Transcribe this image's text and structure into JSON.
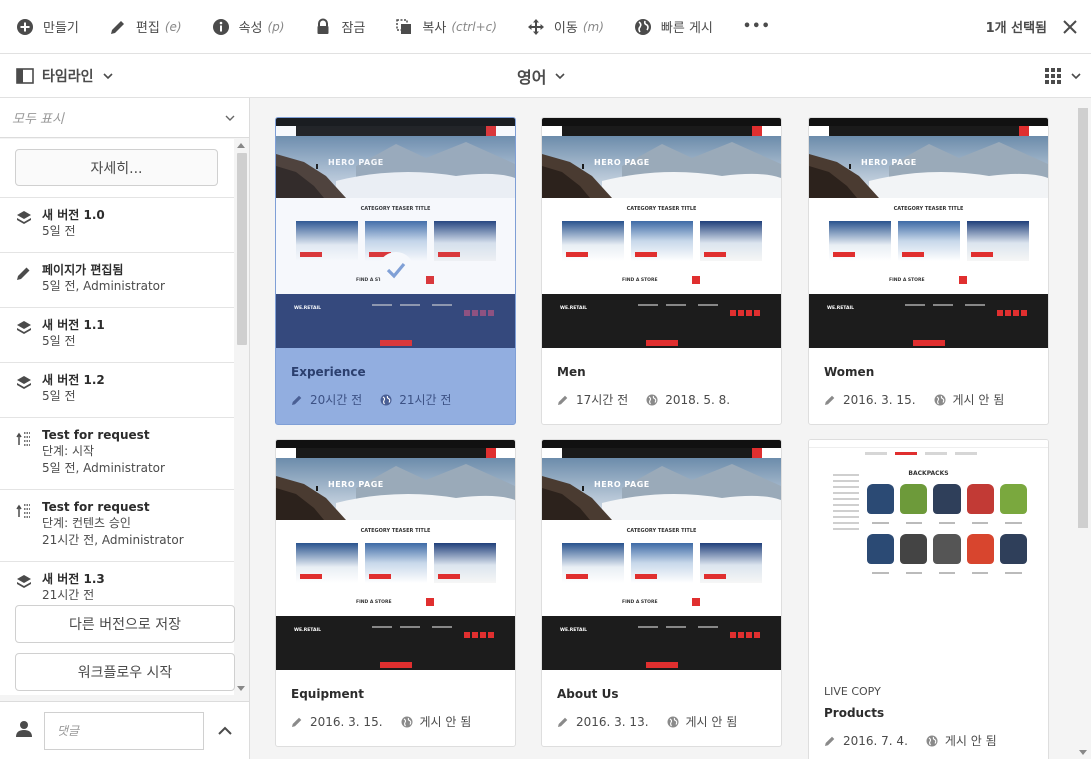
{
  "toolbar": {
    "create": "만들기",
    "edit": "편집",
    "edit_key": "(e)",
    "properties": "속성",
    "properties_key": "(p)",
    "lock": "잠금",
    "copy": "복사",
    "copy_key": "(ctrl+c)",
    "move": "이동",
    "move_key": "(m)",
    "quick_publish": "빠른 게시",
    "more": "•••",
    "selection_count": "1개 선택됨"
  },
  "subbar": {
    "rail": "타임라인",
    "language": "영어"
  },
  "rail": {
    "filter": "모두 표시",
    "more_button": "자세히...",
    "items": [
      {
        "title": "새 버전 1.0",
        "line1": "5일 전",
        "line2": ""
      },
      {
        "title": "페이지가 편집됨",
        "line1": "5일 전, Administrator",
        "line2": ""
      },
      {
        "title": "새 버전 1.1",
        "line1": "5일 전",
        "line2": ""
      },
      {
        "title": "새 버전 1.2",
        "line1": "5일 전",
        "line2": ""
      },
      {
        "title": "Test for request",
        "line1": "단계: 시작",
        "line2": "5일 전, Administrator"
      },
      {
        "title": "Test for request",
        "line1": "단계: 컨텐츠 승인",
        "line2": "21시간 전, Administrator"
      },
      {
        "title": "새 버전 1.3",
        "line1": "21시간 전",
        "line2": ""
      }
    ],
    "save_version": "다른 버전으로 저장",
    "start_workflow": "워크플로우 시작",
    "comment_placeholder": "댓글"
  },
  "cards": [
    {
      "title": "Experience",
      "label": "",
      "modified": "20시간 전",
      "published": "21시간 전",
      "selected": true,
      "thumb_type": "page",
      "hero_text": "HERO PAGE"
    },
    {
      "title": "Men",
      "label": "",
      "modified": "17시간 전",
      "published": "2018. 5. 8.",
      "selected": false,
      "thumb_type": "page",
      "hero_text": "HERO PAGE"
    },
    {
      "title": "Women",
      "label": "",
      "modified": "2016. 3. 15.",
      "published": "게시 안 됨",
      "selected": false,
      "thumb_type": "page",
      "hero_text": "HERO PAGE"
    },
    {
      "title": "Equipment",
      "label": "",
      "modified": "2016. 3. 15.",
      "published": "게시 안 됨",
      "selected": false,
      "thumb_type": "page",
      "hero_text": "HERO PAGE"
    },
    {
      "title": "About Us",
      "label": "",
      "modified": "2016. 3. 13.",
      "published": "게시 안 됨",
      "selected": false,
      "thumb_type": "page",
      "hero_text": "HERO PAGE"
    },
    {
      "title": "Products",
      "label": "LIVE COPY",
      "modified": "2016. 7. 4.",
      "published": "게시 안 됨",
      "selected": false,
      "thumb_type": "products",
      "hero_text": "BACKPACKS"
    }
  ],
  "thumb_text": {
    "teaser_title": "CATEGORY TEASER TITLE",
    "find_store": "FIND A STORE",
    "brand": "WE.RETAIL"
  },
  "colors": {
    "accent": "#e02f2f",
    "selected_card": "#92aee0",
    "text": "#4b4b4b"
  },
  "icons": {
    "create": "plus-circle-icon",
    "edit": "pencil-icon",
    "properties": "info-icon",
    "lock": "lock-icon",
    "copy": "copy-icon",
    "move": "move-icon",
    "quick_publish": "globe-icon",
    "close": "close-icon",
    "rail": "rail-icon",
    "view": "grid-view-icon"
  }
}
